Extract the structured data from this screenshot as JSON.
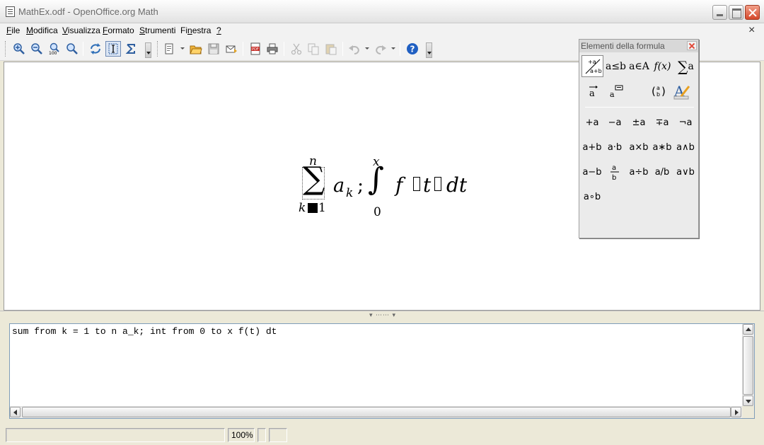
{
  "window": {
    "title": "MathEx.odf - OpenOffice.org Math"
  },
  "menu": {
    "items": [
      {
        "label": "File",
        "mnemonic": "F",
        "rest": "ile"
      },
      {
        "label": "Modifica",
        "mnemonic": "M",
        "rest": "odifica"
      },
      {
        "label": "Visualizza",
        "mnemonic": "V",
        "rest": "isualizza"
      },
      {
        "label": "Formato",
        "mnemonic": "F",
        "rest": "ormato"
      },
      {
        "label": "Strumenti",
        "mnemonic": "S",
        "rest": "trumenti"
      },
      {
        "label": "Finestra",
        "prefix": "Fi",
        "mnemonic": "n",
        "rest": "estra"
      },
      {
        "label": "?",
        "mnemonic": "?",
        "rest": ""
      }
    ],
    "close_doc": "×"
  },
  "toolbar": {
    "buttons": [
      {
        "name": "zoom-in",
        "icon": "zoom-in-icon"
      },
      {
        "name": "zoom-out",
        "icon": "zoom-out-icon"
      },
      {
        "name": "zoom-100",
        "icon": "zoom-100-icon",
        "label": "100"
      },
      {
        "name": "zoom-all",
        "icon": "zoom-all-icon"
      },
      {
        "name": "update",
        "icon": "refresh-icon"
      },
      {
        "name": "formula-cursor",
        "icon": "cursor-icon",
        "active": true
      },
      {
        "name": "symbols",
        "icon": "sigma-icon"
      },
      {
        "name": "new",
        "icon": "new-document-icon"
      },
      {
        "name": "open",
        "icon": "open-folder-icon"
      },
      {
        "name": "save",
        "icon": "save-icon"
      },
      {
        "name": "email",
        "icon": "email-icon"
      },
      {
        "name": "export-pdf",
        "icon": "pdf-icon",
        "label": "PDF"
      },
      {
        "name": "print",
        "icon": "print-icon"
      },
      {
        "name": "cut",
        "icon": "cut-icon"
      },
      {
        "name": "copy",
        "icon": "copy-icon"
      },
      {
        "name": "paste",
        "icon": "paste-icon"
      },
      {
        "name": "undo",
        "icon": "undo-icon"
      },
      {
        "name": "redo",
        "icon": "redo-icon"
      },
      {
        "name": "help",
        "icon": "help-icon",
        "label": "?"
      }
    ]
  },
  "formula": {
    "sum_upper": "n",
    "sum_lower_var": "k",
    "sum_lower_val": "1",
    "sum_symbol": "∑",
    "term": "a",
    "term_sub": "k",
    "separator": ";",
    "int_symbol": "∫",
    "int_upper": "x",
    "int_lower": "0",
    "integrand": "f",
    "var": "t",
    "differential": "dt"
  },
  "command": {
    "text": "sum from k = 1 to n a_k; int from 0 to x f(t) dt"
  },
  "status": {
    "zoom": "100%"
  },
  "palette": {
    "title": "Elementi della formula",
    "categories": [
      {
        "name": "unary-binary",
        "glyph": "+a / a+b",
        "selected": true
      },
      {
        "name": "relations",
        "glyph": "a≤b"
      },
      {
        "name": "set-operations",
        "glyph": "a∈A"
      },
      {
        "name": "functions",
        "glyph": "f(x)"
      },
      {
        "name": "operators",
        "glyph": "∑a"
      },
      {
        "name": "attributes",
        "glyph": "a⃗"
      },
      {
        "name": "others",
        "glyph": "a💬"
      },
      {
        "name": "brackets",
        "glyph": "(a b)"
      },
      {
        "name": "format",
        "glyph": "A"
      }
    ],
    "operators": [
      [
        "+a",
        "−a",
        "±a",
        "∓a",
        "¬a"
      ],
      [
        "a+b",
        "a·b",
        "a×b",
        "a∗b",
        "a∧b"
      ],
      [
        "a−b",
        "a/b frac",
        "a÷b",
        "a/b",
        "a∨b"
      ],
      [
        "a∘b"
      ]
    ]
  }
}
